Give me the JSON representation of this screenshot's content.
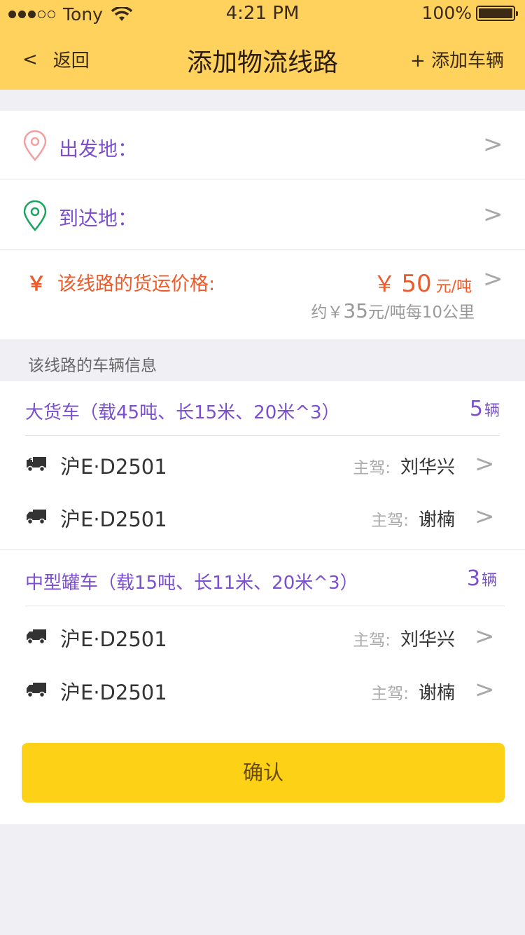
{
  "status_bar": {
    "carrier": "Tony",
    "time": "4:21 PM",
    "battery": "100%"
  },
  "nav": {
    "back_icon": "<",
    "back_label": "返回",
    "title": "添加物流线路",
    "add_label": "+ 添加车辆"
  },
  "form": {
    "origin_label": "出发地：",
    "destination_label": "到达地：",
    "price_label": "该线路的货运价格:",
    "price_symbol": "￥",
    "price_value": "50",
    "price_unit": "元/吨",
    "price_sub_prefix": "约￥",
    "price_sub_value": "35",
    "price_sub_suffix": "元/吨每10公里",
    "arrow": ">"
  },
  "colors": {
    "header": "#ffd25e",
    "accent_purple": "#7b4fd0",
    "price_orange": "#ef5a2a",
    "confirm": "#fdd116"
  },
  "vehicles_section": {
    "title": "该线路的车辆信息",
    "groups": [
      {
        "title": "大货车（载45吨、长15米、20米^3）",
        "count": "5",
        "count_unit": "辆",
        "vehicles": [
          {
            "plate": "沪E·D2501",
            "driver_label": "主驾:",
            "driver": "刘华兴"
          },
          {
            "plate": "沪E·D2501",
            "driver_label": "主驾:",
            "driver": "谢楠"
          }
        ]
      },
      {
        "title": "中型罐车（载15吨、长11米、20米^3）",
        "count": "3",
        "count_unit": "辆",
        "vehicles": [
          {
            "plate": "沪E·D2501",
            "driver_label": "主驾:",
            "driver": "刘华兴"
          },
          {
            "plate": "沪E·D2501",
            "driver_label": "主驾:",
            "driver": "谢楠"
          }
        ]
      }
    ]
  },
  "confirm_label": "确认",
  "icons": {
    "origin": "location-pin-icon",
    "destination": "location-pin-icon",
    "price": "yen-icon",
    "vehicle": "truck-icon"
  }
}
